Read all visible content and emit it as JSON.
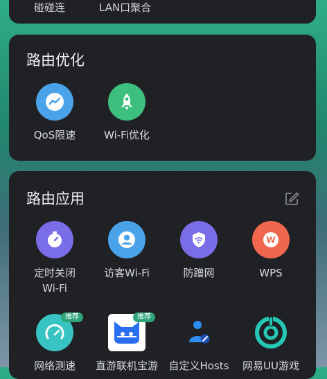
{
  "top_card": {
    "items": [
      {
        "label": "碰碰连"
      },
      {
        "label": "LAN口聚合"
      }
    ]
  },
  "optimization": {
    "title": "路由优化",
    "items": [
      {
        "label": "QoS限速",
        "icon": "speed-chart-icon",
        "color": "#4aa3e8"
      },
      {
        "label": "Wi-Fi优化",
        "icon": "rocket-icon",
        "color": "#3dbf7d"
      }
    ]
  },
  "applications": {
    "title": "路由应用",
    "edit_icon": "edit-icon",
    "items": [
      {
        "label": "定时关闭\nWi-Fi",
        "icon": "timer-icon",
        "color": "#7a6de8"
      },
      {
        "label": "访客Wi-Fi",
        "icon": "guest-user-icon",
        "color": "#4aa3e8"
      },
      {
        "label": "防蹭网",
        "icon": "shield-wifi-icon",
        "color": "#7a6de8"
      },
      {
        "label": "WPS",
        "icon": "wps-icon",
        "color": "#f0674d"
      },
      {
        "label": "网络测速",
        "icon": "speedometer-icon",
        "color": "#37c4c2",
        "badge": "推荐"
      },
      {
        "label": "直游联机宝游",
        "icon": "game-face-icon",
        "color": "#ffffff",
        "badge": "推荐"
      },
      {
        "label": "自定义Hosts",
        "icon": "user-edit-icon",
        "color": "#2e8ef0"
      },
      {
        "label": "网易UU游戏",
        "icon": "uu-logo-icon",
        "color": "#25c8b4"
      }
    ]
  }
}
